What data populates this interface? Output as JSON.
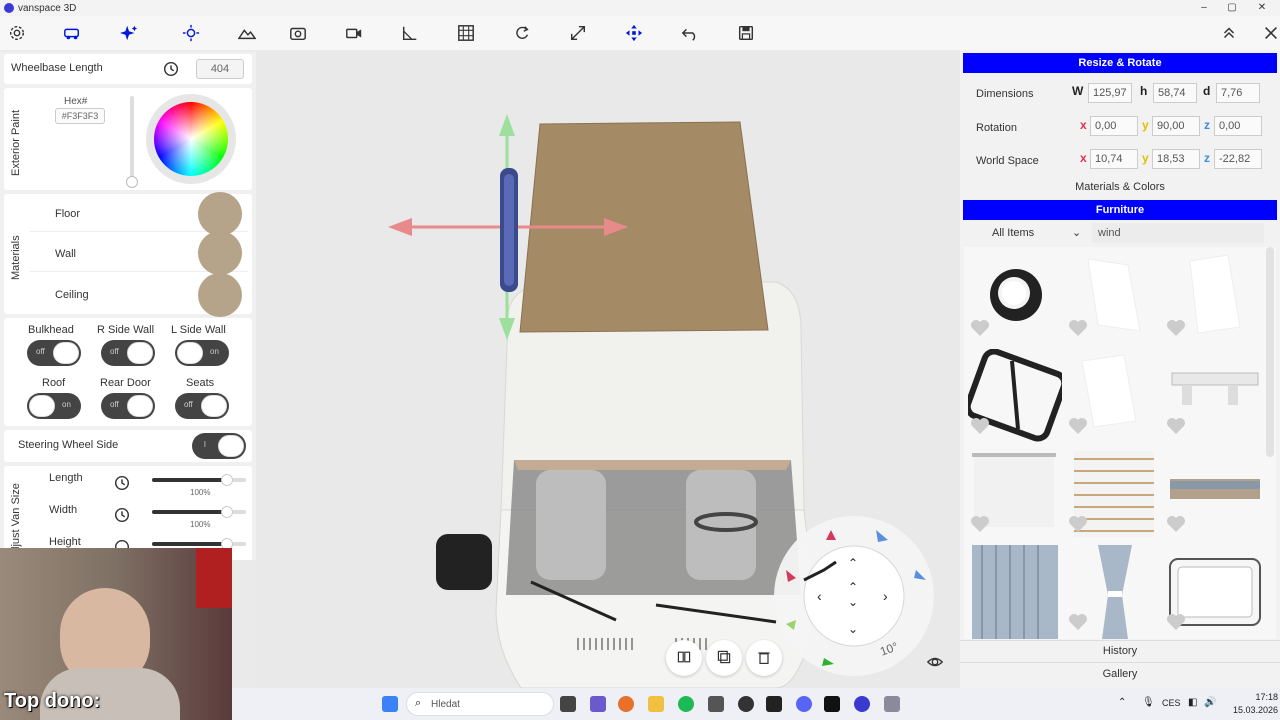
{
  "window": {
    "title": "vanspace 3D",
    "controls": [
      "–",
      "▢",
      "✕"
    ]
  },
  "toolbar": {
    "icons": [
      "gear-icon",
      "van-icon",
      "sparkle-icon",
      "sun-icon",
      "mountain-icon",
      "camera-icon",
      "video-icon",
      "ruler-icon",
      "grid-icon",
      "rotate-icon",
      "resize-icon",
      "move-icon",
      "undo-icon",
      "save-icon"
    ],
    "right": [
      "collapse-icon",
      "close-icon"
    ]
  },
  "left": {
    "wheelbase": {
      "label": "Wheelbase Length",
      "value": "404"
    },
    "exterior": {
      "section": "Exterior Paint",
      "hex_label": "Hex#",
      "hex_value": "#F3F3F3"
    },
    "materials": {
      "section": "Materials",
      "items": [
        "Floor",
        "Wall",
        "Ceiling"
      ]
    },
    "toggles": [
      {
        "label": "Bulkhead",
        "state": "off"
      },
      {
        "label": "R Side Wall",
        "state": "off"
      },
      {
        "label": "L Side Wall",
        "state": "on"
      },
      {
        "label": "Roof",
        "state": "on"
      },
      {
        "label": "Rear Door",
        "state": "off"
      },
      {
        "label": "Seats",
        "state": "off"
      }
    ],
    "steering": {
      "label": "Steering Wheel Side",
      "state": "l"
    },
    "size": {
      "section": "Adjust Van Size",
      "items": [
        {
          "label": "Length",
          "pct": "100%",
          "level": 0.8
        },
        {
          "label": "Width",
          "pct": "100%",
          "level": 0.8
        },
        {
          "label": "Height",
          "pct": "",
          "level": 0.8
        }
      ]
    }
  },
  "right": {
    "resize_title": "Resize & Rotate",
    "dimensions": {
      "label": "Dimensions",
      "w_label": "W",
      "w": "125,97",
      "h_label": "h",
      "h": "58,74",
      "d_label": "d",
      "d": "7,76"
    },
    "rotation": {
      "label": "Rotation",
      "x": "0,00",
      "y": "90,00",
      "z": "0,00"
    },
    "world": {
      "label": "World Space",
      "x": "10,74",
      "y": "18,53",
      "z": "-22,82"
    },
    "axis": {
      "x": "x",
      "y": "y",
      "z": "z"
    },
    "materials_link": "Materials & Colors",
    "furniture_title": "Furniture",
    "filter": "All Items",
    "search": "wind",
    "history": "History",
    "gallery": "Gallery"
  },
  "viewport": {
    "rotation_step": "10°"
  },
  "webcam": {
    "caption": "Top dono:"
  },
  "taskbar": {
    "search_placeholder": "Hledat",
    "lang": "CES",
    "time": "17:18",
    "date": "15.03.2026"
  },
  "colors": {
    "accent": "#0000ff",
    "material": "#b5a38a",
    "toggle_bg": "#444444"
  }
}
